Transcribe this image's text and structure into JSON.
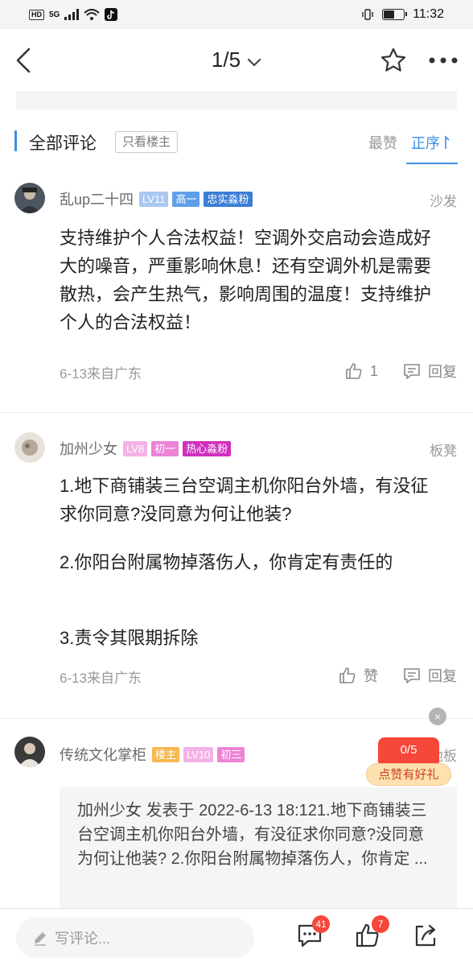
{
  "status_bar": {
    "hd": "HD",
    "net": "5G",
    "time": "11:32"
  },
  "nav": {
    "page_indicator": "1/5"
  },
  "section": {
    "title": "全部评论",
    "filter": "只看楼主",
    "sort_like": "最赞",
    "sort_order": "正序"
  },
  "comments": [
    {
      "username": "乱up二十四",
      "tags": [
        {
          "text": "LV11",
          "color": "#a9c7f0"
        },
        {
          "text": "高一",
          "color": "#5f9fe8"
        },
        {
          "text": "忠实淼粉",
          "color": "#3b7ed6"
        }
      ],
      "floor": "沙发",
      "text": "支持维护个人合法权益！空调外交启动会造成好大的噪音，严重影响休息！还有空调外机是需要散热，会产生热气，影响周围的温度！支持维护个人的合法权益！",
      "meta": "6-13来自广东",
      "like": "1",
      "reply": "回复"
    },
    {
      "username": "加州少女",
      "tags": [
        {
          "text": "LV8",
          "color": "#f3b2e6"
        },
        {
          "text": "初一",
          "color": "#ec83d6"
        },
        {
          "text": "热心淼粉",
          "color": "#d02fc0"
        }
      ],
      "floor": "板凳",
      "paragraphs": [
        "1.地下商铺装三台空调主机你阳台外墙，有没征求你同意?没同意为何让他装?",
        "2.你阳台附属物掉落伤人，你肯定有责任的",
        "3.责令其限期拆除"
      ],
      "meta": "6-13来自广东",
      "like": "赞",
      "reply": "回复"
    },
    {
      "username": "传统文化掌柜",
      "tags": [
        {
          "text": "楼主",
          "color": "#f6b850"
        },
        {
          "text": "LV10",
          "color": "#f3b2e6"
        },
        {
          "text": "初三",
          "color": "#ec83d6"
        }
      ],
      "floor": "地板",
      "quote": "加州少女 发表于 2022-6-13 18:121.地下商铺装三台空调主机你阳台外墙，有没征求你同意?没同意为何让他装? 2.你阳台附属物掉落伤人，你肯定 ..."
    }
  ],
  "promo": {
    "count": "0/5",
    "label": "点赞有好礼",
    "close": "×"
  },
  "bottom_bar": {
    "placeholder": "写评论...",
    "comment_count": "41",
    "like_count": "7"
  },
  "colors": {
    "accent": "#3a8ee6",
    "badge_red": "#f5473a"
  },
  "icons": [
    "back-icon",
    "chevron-down-icon",
    "star-icon",
    "more-icon",
    "thumb-up-icon",
    "reply-icon",
    "pencil-icon",
    "comments-icon",
    "share-icon"
  ]
}
